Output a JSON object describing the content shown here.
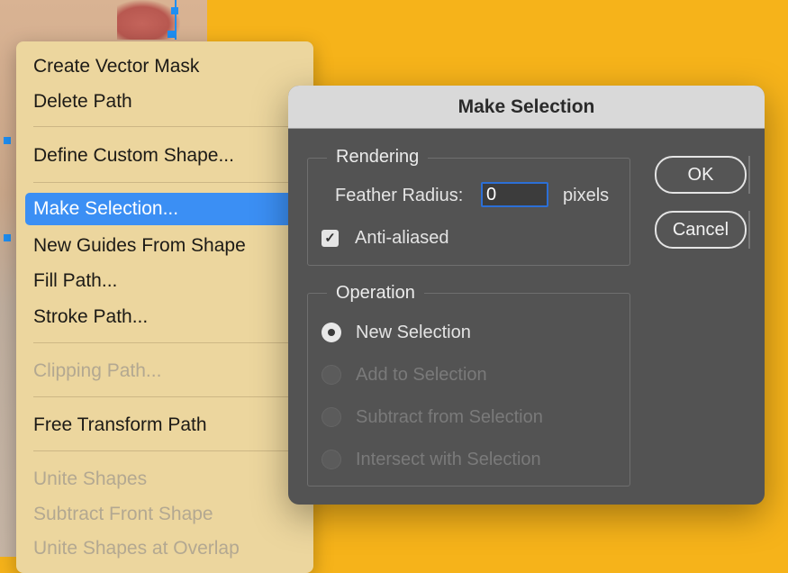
{
  "menu": {
    "items": [
      {
        "label": "Create Vector Mask",
        "state": "enabled"
      },
      {
        "label": "Delete Path",
        "state": "enabled"
      },
      {
        "label": "Define Custom Shape...",
        "state": "enabled"
      },
      {
        "label": "Make Selection...",
        "state": "highlighted"
      },
      {
        "label": "New Guides From Shape",
        "state": "enabled"
      },
      {
        "label": "Fill Path...",
        "state": "enabled"
      },
      {
        "label": "Stroke Path...",
        "state": "enabled"
      },
      {
        "label": "Clipping Path...",
        "state": "disabled"
      },
      {
        "label": "Free Transform Path",
        "state": "enabled"
      },
      {
        "label": "Unite Shapes",
        "state": "disabled"
      },
      {
        "label": "Subtract Front Shape",
        "state": "disabled"
      },
      {
        "label": "Unite Shapes at Overlap",
        "state": "disabled"
      }
    ]
  },
  "dialog": {
    "title": "Make Selection",
    "rendering": {
      "group_label": "Rendering",
      "feather_label": "Feather Radius:",
      "feather_value": "0",
      "feather_unit": "pixels",
      "anti_aliased_label": "Anti-aliased",
      "anti_aliased_checked": true
    },
    "operation": {
      "group_label": "Operation",
      "options": [
        {
          "label": "New Selection",
          "selected": true,
          "enabled": true
        },
        {
          "label": "Add to Selection",
          "selected": false,
          "enabled": false
        },
        {
          "label": "Subtract from Selection",
          "selected": false,
          "enabled": false
        },
        {
          "label": "Intersect with Selection",
          "selected": false,
          "enabled": false
        }
      ]
    },
    "buttons": {
      "ok": "OK",
      "cancel": "Cancel"
    }
  },
  "colors": {
    "canvas_background": "#f6b31a",
    "menu_background": "#ecd69e",
    "menu_highlight": "#3b8ff4",
    "dialog_background": "#535353",
    "dialog_titlebar": "#d9d9d9",
    "path_stroke": "#1f8ff2"
  }
}
